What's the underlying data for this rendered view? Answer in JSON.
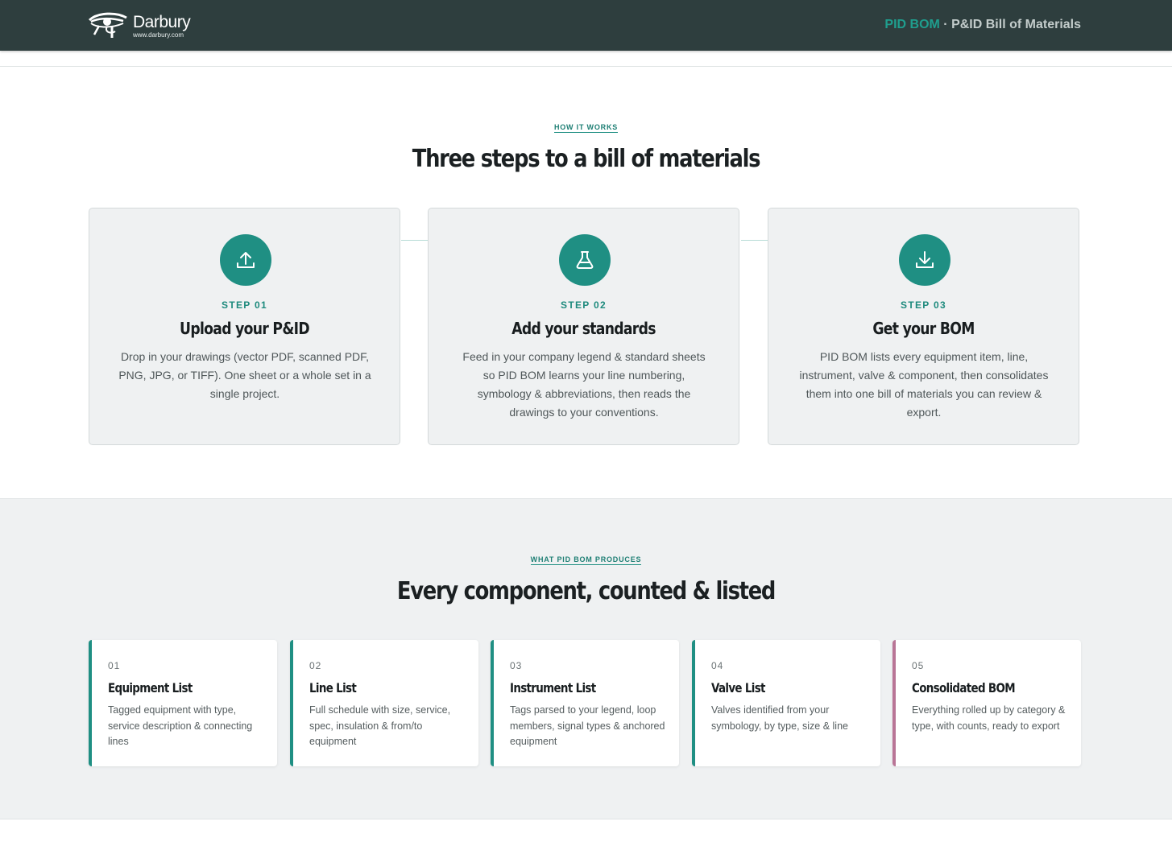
{
  "header": {
    "logo_name": "Darbury",
    "logo_url": "www.darbury.com",
    "brand": "PID BOM",
    "separator_title": " · P&ID Bill of Materials"
  },
  "how_it_works": {
    "eyebrow": "HOW IT WORKS",
    "title": "Three steps to a bill of materials",
    "steps": [
      {
        "icon": "upload-icon",
        "label": "STEP 01",
        "title": "Upload your P&ID",
        "description": "Drop in your drawings (vector PDF, scanned PDF, PNG, JPG, or TIFF). One sheet or a whole set in a single project."
      },
      {
        "icon": "flask-icon",
        "label": "STEP 02",
        "title": "Add your standards",
        "description": "Feed in your company legend & standard sheets so PID BOM learns your line numbering, symbology & abbreviations, then reads the drawings to your conventions."
      },
      {
        "icon": "download-icon",
        "label": "STEP 03",
        "title": "Get your BOM",
        "description": "PID BOM lists every equipment item, line, instrument, valve & component, then consolidates them into one bill of materials you can review & export."
      }
    ]
  },
  "produces": {
    "eyebrow": "WHAT PID BOM PRODUCES",
    "title": "Every component, counted & listed",
    "items": [
      {
        "num": "01",
        "title": "Equipment List",
        "description": "Tagged equipment with type, service description & connecting lines",
        "accent": "#1f8f83"
      },
      {
        "num": "02",
        "title": "Line List",
        "description": "Full schedule with size, service, spec, insulation & from/to equipment",
        "accent": "#1f8f83"
      },
      {
        "num": "03",
        "title": "Instrument List",
        "description": "Tags parsed to your legend, loop members, signal types & anchored equipment",
        "accent": "#1f8f83"
      },
      {
        "num": "04",
        "title": "Valve List",
        "description": "Valves identified from your symbology, by type, size & line",
        "accent": "#1f8f83"
      },
      {
        "num": "05",
        "title": "Consolidated BOM",
        "description": "Everything rolled up by category & type, with counts, ready to export",
        "accent": "#b97596"
      }
    ]
  },
  "colors": {
    "header_bg": "#2e3e3e",
    "accent_teal": "#1f8f83",
    "accent_pink": "#b97596"
  }
}
